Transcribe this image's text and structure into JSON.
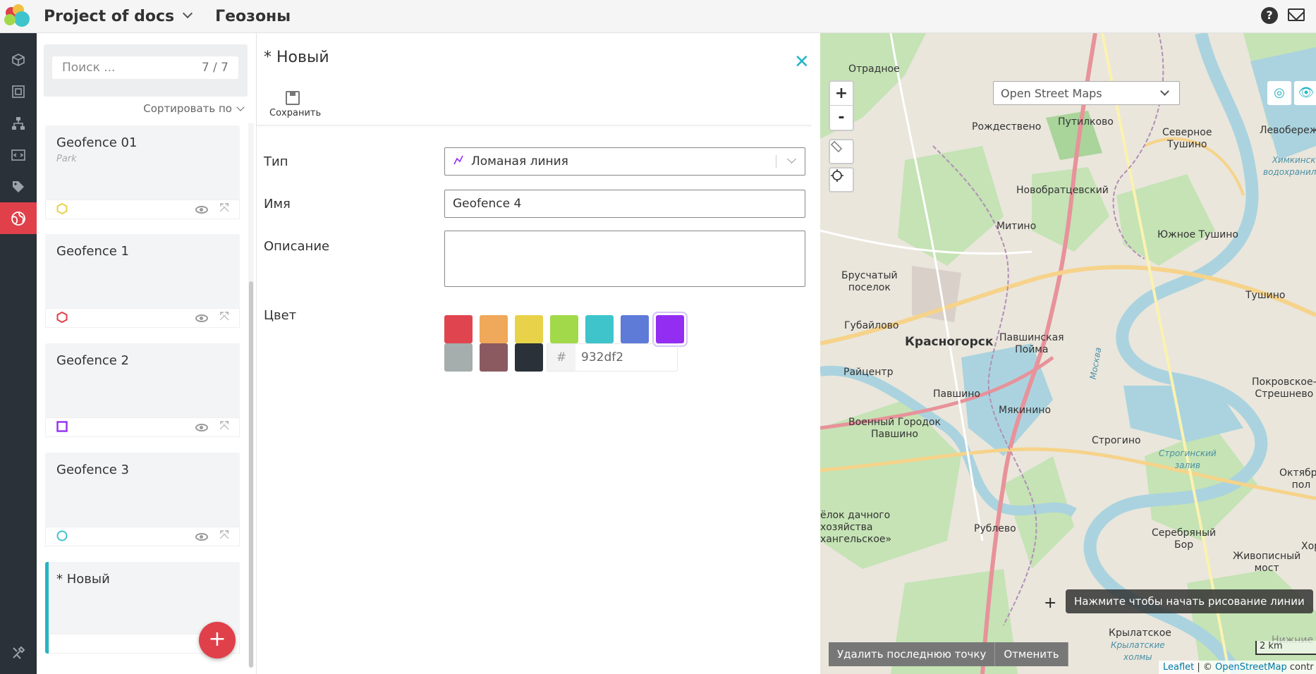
{
  "header": {
    "project": "Project of docs",
    "section": "Геозоны"
  },
  "nav": {
    "items": [
      "cube-icon",
      "frame-icon",
      "hierarchy-icon",
      "code-icon",
      "tag-icon",
      "globe-icon"
    ],
    "active": "globe-icon",
    "bottom": "tools-icon"
  },
  "list": {
    "search_placeholder": "Поиск ...",
    "count": "7 / 7",
    "sort_label": "Сортировать по",
    "items": [
      {
        "title": "Geofence 01",
        "subtitle": "Park",
        "shape": "hexagon",
        "color": "#e8d24a"
      },
      {
        "title": "Geofence 1",
        "subtitle": "",
        "shape": "hexagon",
        "color": "#e0404a"
      },
      {
        "title": "Geofence 2",
        "subtitle": "",
        "shape": "square",
        "color": "#932df2"
      },
      {
        "title": "Geofence 3",
        "subtitle": "",
        "shape": "circle",
        "color": "#3fc4cc"
      },
      {
        "title": "* Новый",
        "subtitle": "",
        "shape": "",
        "color": ""
      }
    ],
    "add_label": "+"
  },
  "editor": {
    "title": "* Новый",
    "save_label": "Сохранить",
    "type_label": "Тип",
    "type_value": "Ломаная линия",
    "name_label": "Имя",
    "name_value": "Geofence 4",
    "desc_label": "Описание",
    "desc_value": "",
    "color_label": "Цвет",
    "colors": [
      "#e0454f",
      "#f0a85a",
      "#e8d24a",
      "#a2d94a",
      "#3fc4cc",
      "#5e7bd8",
      "#932df2",
      "#a5adad",
      "#8a5a60",
      "#2a3138"
    ],
    "selected_color": "#932df2",
    "hex_prefix": "#",
    "hex_value": "932df2"
  },
  "map": {
    "layer": "Open Street Maps",
    "zoom_in": "+",
    "zoom_out": "-",
    "tooltip": "Нажмите чтобы начать рисование линии",
    "delete_last": "Удалить последнюю точку",
    "cancel": "Отменить",
    "scale": "2 km",
    "attr_leaflet": "Leaflet",
    "attr_sep": " | © ",
    "attr_osm": "OpenStreetMap",
    "attr_tail": " contr",
    "labels": {
      "otradnoe": "Отрадное",
      "rozhdestveno": "Рождествено",
      "putilkovo": "Путилково",
      "severnoe_tushino": "Северное\nТушино",
      "levoberezh": "Левобереж",
      "novobratcevsky": "Новобратцевский",
      "mitino": "Митино",
      "yuzhnoe_tushino": "Южное Тушино",
      "bruschaty": "Брусчатый\nпоселок",
      "tushino": "Тушино",
      "gubailovo": "Губайлово",
      "krasnogorsk": "Красногорск",
      "pavshinskaya": "Павшинская\nПойма",
      "raycentr": "Райцентр",
      "pavshino": "Павшино",
      "pokrovskoe": "Покровское-\nСтрешнево",
      "myakinino": "Мякинино",
      "voenny": "Военный Городок\nПавшино",
      "strogino": "Строгино",
      "oktyabr": "Октябрь\nпол",
      "posyolok": "ёлок дачного\nхозяйства\nхангельское»",
      "rublevo": "Рублево",
      "serebryany": "Серебряный\nБор",
      "zhivopisny": "Живописный\nмост",
      "hor": "Хор",
      "krylatskoe": "Крылатское",
      "nizhnie": "Нижние Мнё",
      "khimki_res": "Химкинское\nводохранилище",
      "stroginsky_bay": "Строгинский\nзалив",
      "krylatskie": "Крылатские\nхолмы",
      "moskva_river": "Москва"
    }
  }
}
